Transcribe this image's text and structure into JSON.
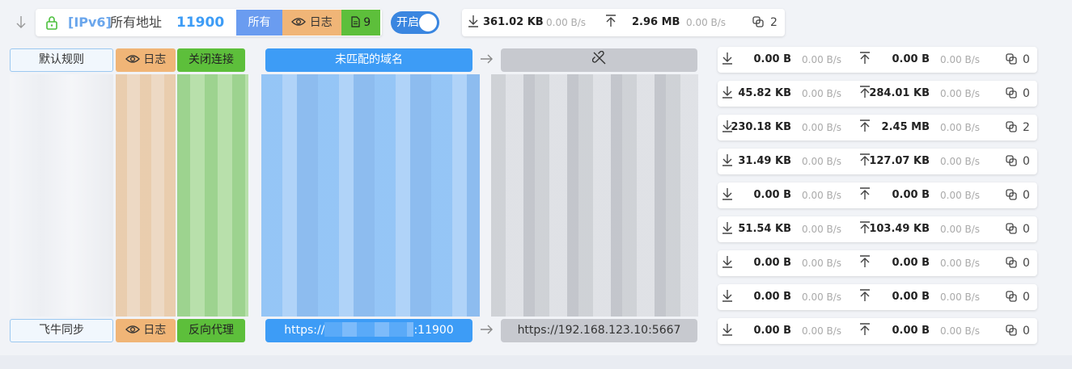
{
  "header": {
    "collapse_icon": "arrow-down-icon",
    "lock_icon": "lock-icon",
    "proto": "[IPv6]",
    "address_label": "所有地址",
    "port": "11900",
    "filter_all": "所有",
    "log_label": "日志",
    "rule_count": "9",
    "toggle_label": "开启",
    "stats": {
      "download": "361.02 KB",
      "download_rate": "0.00 B/s",
      "upload": "2.96 MB",
      "upload_rate": "0.00 B/s",
      "connections": "2"
    }
  },
  "rules": {
    "first": {
      "name": "默认规则",
      "log_label": "日志",
      "action_label": "关闭连接",
      "source": "未匹配的域名",
      "target_icon": "unlink-icon"
    },
    "last": {
      "name": "飞牛同步",
      "log_label": "日志",
      "action_label": "反向代理",
      "source_prefix": "https://",
      "source_suffix": ":11900",
      "target": "https://192.168.123.10:5667"
    }
  },
  "stats_rows": [
    {
      "down": "0.00 B",
      "down_rate": "0.00 B/s",
      "up": "0.00 B",
      "up_rate": "0.00 B/s",
      "conn": "0"
    },
    {
      "down": "45.82 KB",
      "down_rate": "0.00 B/s",
      "up": "284.01 KB",
      "up_rate": "0.00 B/s",
      "conn": "0"
    },
    {
      "down": "230.18 KB",
      "down_rate": "0.00 B/s",
      "up": "2.45 MB",
      "up_rate": "0.00 B/s",
      "conn": "2"
    },
    {
      "down": "31.49 KB",
      "down_rate": "0.00 B/s",
      "up": "127.07 KB",
      "up_rate": "0.00 B/s",
      "conn": "0"
    },
    {
      "down": "0.00 B",
      "down_rate": "0.00 B/s",
      "up": "0.00 B",
      "up_rate": "0.00 B/s",
      "conn": "0"
    },
    {
      "down": "51.54 KB",
      "down_rate": "0.00 B/s",
      "up": "103.49 KB",
      "up_rate": "0.00 B/s",
      "conn": "0"
    },
    {
      "down": "0.00 B",
      "down_rate": "0.00 B/s",
      "up": "0.00 B",
      "up_rate": "0.00 B/s",
      "conn": "0"
    },
    {
      "down": "0.00 B",
      "down_rate": "0.00 B/s",
      "up": "0.00 B",
      "up_rate": "0.00 B/s",
      "conn": "0"
    },
    {
      "down": "0.00 B",
      "down_rate": "0.00 B/s",
      "up": "0.00 B",
      "up_rate": "0.00 B/s",
      "conn": "0"
    }
  ],
  "colors": {
    "accent_blue": "#3d9cf6",
    "log_orange": "#f0b577",
    "action_green": "#5dbf3b",
    "target_gray": "#c7c9cf",
    "toggle_blue": "#3a86e0"
  }
}
